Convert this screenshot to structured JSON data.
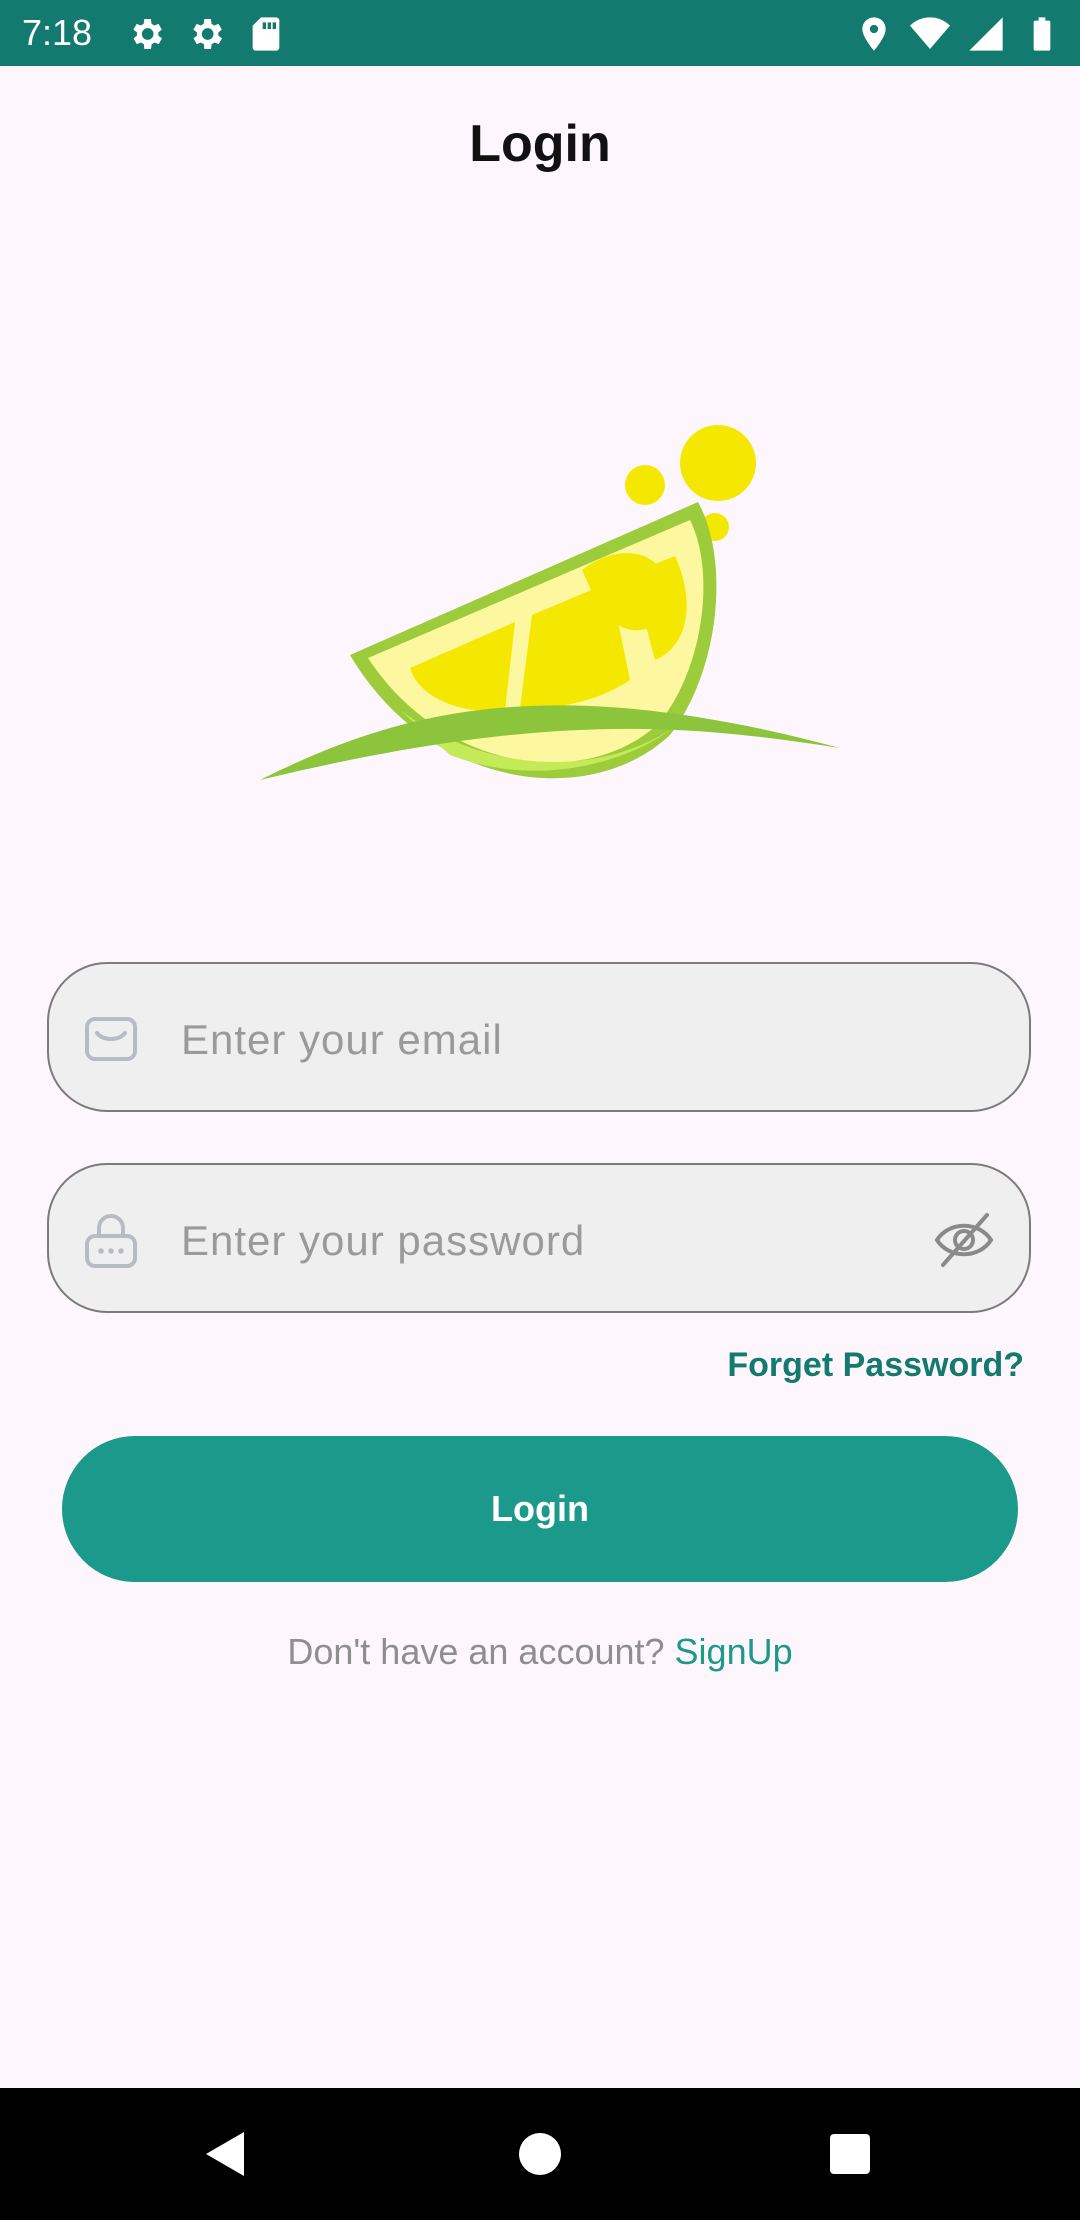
{
  "status_bar": {
    "time": "7:18",
    "icons_left": [
      "settings-icon",
      "settings-icon",
      "sd-card-icon"
    ],
    "icons_right": [
      "location-icon",
      "wifi-icon",
      "signal-icon",
      "battery-icon"
    ]
  },
  "page": {
    "title": "Login"
  },
  "logo": {
    "name": "lemon-slice-logo"
  },
  "email_field": {
    "placeholder": "Enter your email",
    "value": "",
    "icon": "mail-icon"
  },
  "password_field": {
    "placeholder": "Enter your password",
    "value": "",
    "icon": "lock-icon",
    "toggle_icon": "eye-off-icon"
  },
  "forgot_password": {
    "label": "Forget Password?"
  },
  "login_button": {
    "label": "Login"
  },
  "signup": {
    "prompt": "Don't have an account? ",
    "link": "SignUp"
  },
  "colors": {
    "primary": "#1b998b",
    "status_bar": "#137a70",
    "link": "#137a70",
    "background": "#fdf7fd"
  },
  "nav_bar": {
    "buttons": [
      "back-icon",
      "home-icon",
      "recents-icon"
    ]
  }
}
